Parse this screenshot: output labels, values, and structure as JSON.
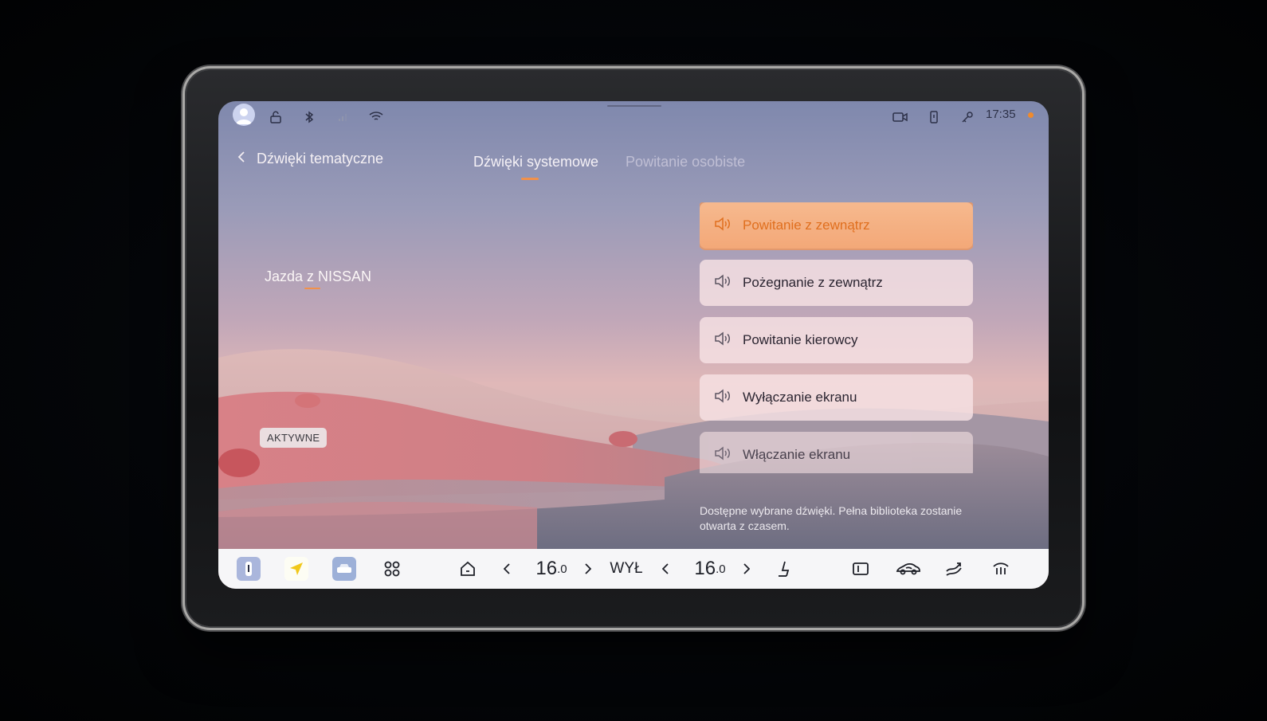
{
  "status_bar": {
    "time": "17:35",
    "left_icons": [
      "user-avatar",
      "lock-open-icon",
      "bluetooth-icon",
      "signal-icon",
      "wifi-icon"
    ],
    "right_icons": [
      "camera-icon",
      "phone-key-icon",
      "key-icon"
    ],
    "indicator_color": "#f08a2c"
  },
  "header": {
    "back_label": "Dźwięki tematyczne",
    "tabs": [
      {
        "label": "Dźwięki systemowe",
        "active": true
      },
      {
        "label": "Powitanie osobiste",
        "active": false
      }
    ]
  },
  "theme": {
    "name": "Jazda z NISSAN",
    "status_badge": "AKTYWNE"
  },
  "sounds": [
    {
      "label": "Powitanie z zewnątrz",
      "active": true
    },
    {
      "label": "Pożegnanie z zewnątrz",
      "active": false
    },
    {
      "label": "Powitanie kierowcy",
      "active": false
    },
    {
      "label": "Wyłączanie ekranu",
      "active": false
    },
    {
      "label": "Włączanie ekranu",
      "active": false
    }
  ],
  "footnote": "Dostępne wybrane dźwięki. Pełna biblioteka zostanie otwarta z czasem.",
  "dock": {
    "left_temp": "16",
    "left_temp_decimal": ".0",
    "fan_label": "WYŁ",
    "right_temp": "16",
    "right_temp_decimal": ".0",
    "accent_color": "#f2914a"
  }
}
